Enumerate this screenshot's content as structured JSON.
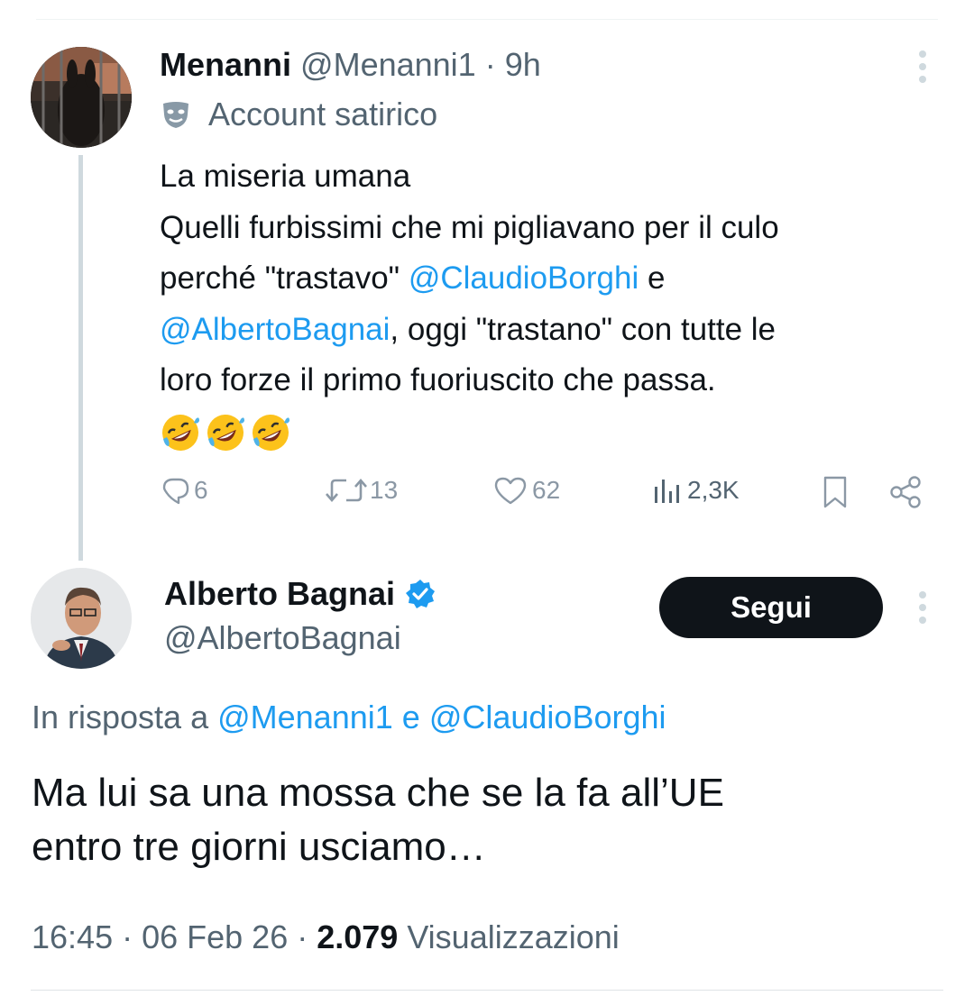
{
  "tweet1": {
    "author_name": "Menanni",
    "handle": "@Menanni1",
    "separator": "·",
    "time": "9h",
    "label": "Account satirico",
    "label_icon": "theater-mask-icon",
    "text": {
      "line1": "La miseria umana",
      "line2": "Quelli furbissimi che mi pigliavano per il culo",
      "line3_a": "perché \"trastavo\" ",
      "line3_mention": "@ClaudioBorghi",
      "line3_b": " e",
      "line4_mention": "@AlbertoBagnai",
      "line4_b": ", oggi \"trastano\" con tutte le",
      "line5": "loro forze il primo fuoriuscito che passa.",
      "emojis": [
        "rolling-on-floor-laughing",
        "rolling-on-floor-laughing",
        "rolling-on-floor-laughing"
      ]
    },
    "actions": {
      "replies": "6",
      "retweets": "13",
      "likes": "62",
      "views": "2,3K"
    }
  },
  "tweet2": {
    "author_name": "Alberto Bagnai",
    "verified": true,
    "handle": "@AlbertoBagnai",
    "follow_label": "Segui",
    "reply_prefix": "In risposta a ",
    "reply_mention_1": "@Menanni1",
    "reply_joiner": " e ",
    "reply_mention_2": "@ClaudioBorghi",
    "text_line1": "Ma lui sa una mossa che se la fa all’UE",
    "text_line2": "entro tre giorni usciamo…",
    "time": "16:45",
    "separator": " · ",
    "date": "06 Feb 26",
    "views_count": "2.079",
    "views_label": " Visualizzazioni"
  },
  "colors": {
    "link": "#1d9bf0",
    "secondary_text": "#536471",
    "action_gray": "#8b98a5",
    "verified_blue": "#1d9bf0",
    "button_bg": "#0f1419"
  }
}
